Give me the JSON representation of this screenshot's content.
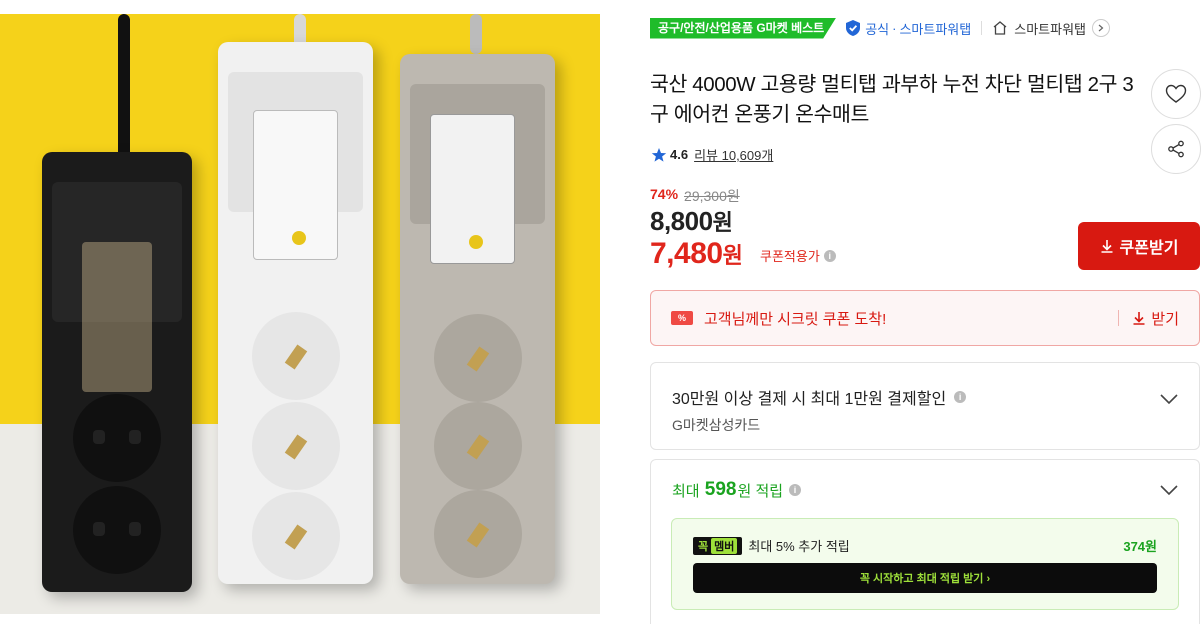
{
  "badges": {
    "category_best": "공구/안전/산업용품 G마켓 베스트",
    "official_label": "공식",
    "official_separator": "·",
    "official_shop": "스마트파워탭",
    "shop_link": "스마트파워탭"
  },
  "product": {
    "title": "국산 4000W 고용량 멀티탭 과부하 누전 차단 멀티탭 2구 3구 에어컨 온풍기 온수매트",
    "rating": "4.6",
    "review_label": "리뷰 10,609개"
  },
  "price": {
    "discount_rate": "74%",
    "original": "29,300원",
    "sale": "8,800",
    "sale_unit": "원",
    "coupon": "7,480",
    "coupon_unit": "원",
    "coupon_applied": "쿠폰적용가",
    "coupon_button": "쿠폰받기"
  },
  "secret_coupon": {
    "ticket": "%",
    "text": "고객님께만 시크릿 쿠폰 도착!",
    "receive": "받기"
  },
  "card_benefit": {
    "title": "30만원 이상 결제 시 최대 1만원 결제할인",
    "card_name": "G마켓삼성카드"
  },
  "points": {
    "prefix": "최대",
    "amount": "598",
    "suffix": "원 적립",
    "member_badge_main": "꼭",
    "member_badge_sub": "멤버",
    "member_text": "최대 5% 추가 적립",
    "member_amount": "374원",
    "member_start": "꼭 시작하고 최대 적립 받기 ›"
  },
  "colors": {
    "red": "#d81911",
    "green": "#1aa31f",
    "blue": "#2266d6",
    "best_badge": "#1fbc2a"
  }
}
